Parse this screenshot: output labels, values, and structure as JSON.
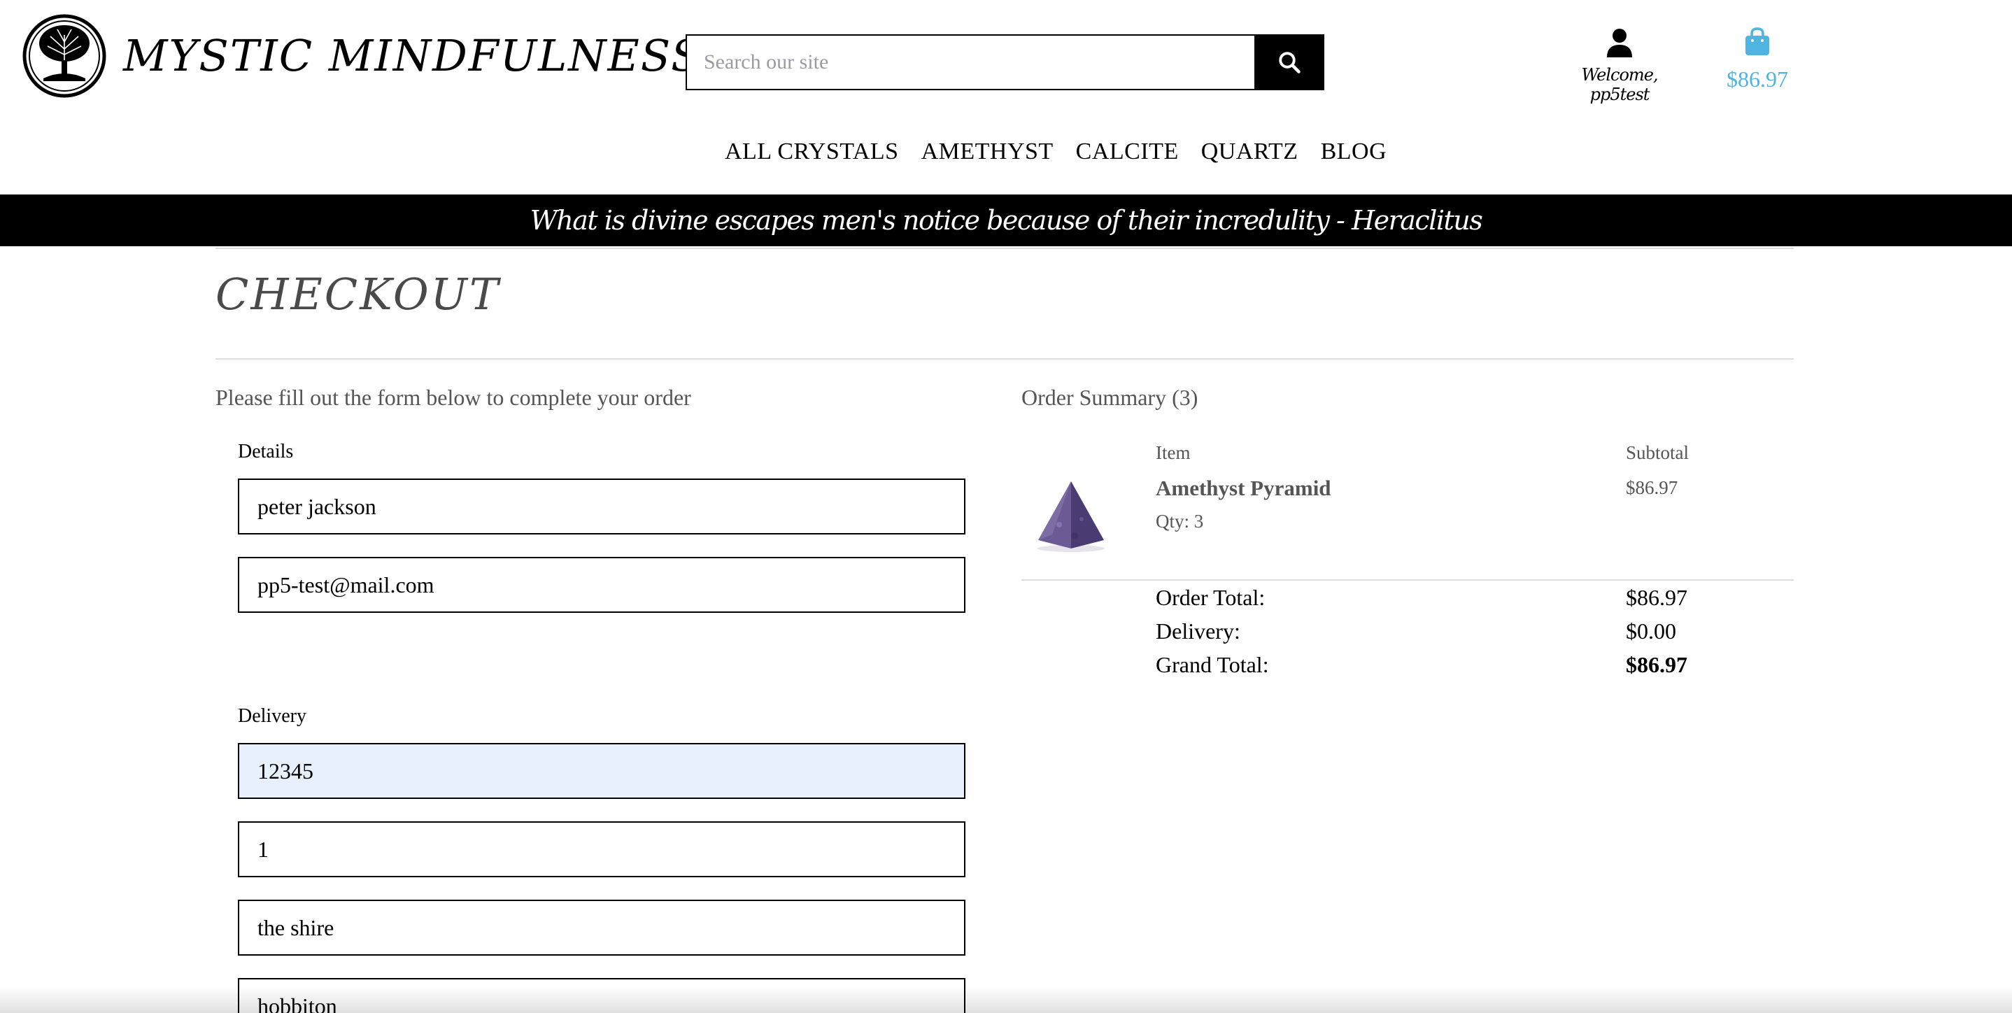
{
  "brand": {
    "name": "MYSTIC MINDFULNESS"
  },
  "search": {
    "placeholder": "Search our site"
  },
  "account": {
    "welcome": "Welcome, pp5test"
  },
  "bag": {
    "total": "$86.97",
    "color": "#4fb5e0"
  },
  "nav": {
    "items": [
      "ALL CRYSTALS",
      "AMETHYST",
      "CALCITE",
      "QUARTZ",
      "BLOG"
    ]
  },
  "quote": "What is divine escapes men's notice because of their incredulity - Heraclitus",
  "page": {
    "title": "CHECKOUT"
  },
  "form": {
    "intro": "Please fill out the form below to complete your order",
    "details_legend": "Details",
    "full_name": "peter jackson",
    "email": "pp5-test@mail.com",
    "delivery_legend": "Delivery",
    "phone": "12345",
    "street1": "1",
    "street2": "the shire",
    "town": "hobbiton"
  },
  "summary": {
    "title": "Order Summary (3)",
    "col_item": "Item",
    "col_subtotal": "Subtotal",
    "product_name": "Amethyst Pyramid",
    "product_qty": "Qty: 3",
    "product_subtotal": "$86.97",
    "order_total_label": "Order Total:",
    "order_total": "$86.97",
    "delivery_label": "Delivery:",
    "delivery": "$0.00",
    "grand_total_label": "Grand Total:",
    "grand_total": "$86.97"
  }
}
